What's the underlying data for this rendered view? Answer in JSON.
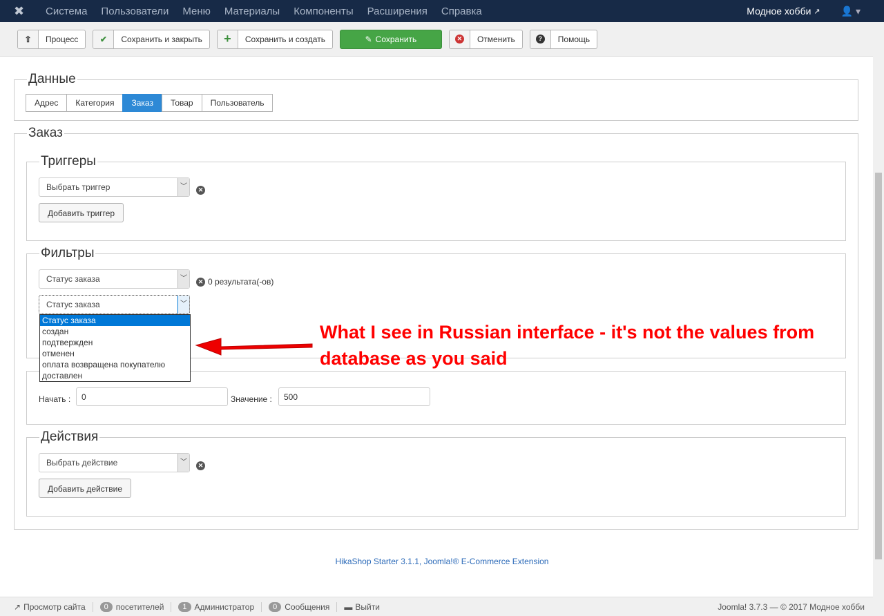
{
  "nav": {
    "items": [
      "Система",
      "Пользователи",
      "Меню",
      "Материалы",
      "Компоненты",
      "Расширения",
      "Справка"
    ],
    "site": "Модное хобби"
  },
  "toolbar": {
    "process": "Процесс",
    "save_close": "Сохранить и закрыть",
    "save_new": "Сохранить и создать",
    "save": "Сохранить",
    "cancel": "Отменить",
    "help": "Помощь"
  },
  "data_section": {
    "legend": "Данные",
    "tabs": [
      "Адрес",
      "Категория",
      "Заказ",
      "Товар",
      "Пользователь"
    ]
  },
  "order": {
    "legend": "Заказ",
    "triggers": {
      "legend": "Триггеры",
      "select": "Выбрать триггер",
      "add": "Добавить триггер"
    },
    "filters": {
      "legend": "Фильтры",
      "select1": "Статус заказа",
      "results": "0 результата(-ов)",
      "select2": "Статус заказа",
      "options": [
        "Статус заказа",
        "создан",
        "подтвержден",
        "отменен",
        "оплата возвращена покупателю",
        "доставлен"
      ]
    },
    "limit": {
      "start_label": "Начать :",
      "start_value": "0",
      "value_label": "Значение :",
      "value_value": "500"
    },
    "actions": {
      "legend": "Действия",
      "select": "Выбрать действие",
      "add": "Добавить действие"
    }
  },
  "annotation": "What I see in Russian interface - it's not the values from database as you said",
  "footer": "HikaShop Starter 3.1.1, Joomla!® E-Commerce Extension",
  "status": {
    "view_site": "Просмотр сайта",
    "visitors_count": "0",
    "visitors": "посетителей",
    "admins_count": "1",
    "admins": "Администратор",
    "messages_count": "0",
    "messages": "Сообщения",
    "logout": "Выйти",
    "version": "Joomla! 3.7.3 — © 2017 Модное хобби"
  }
}
